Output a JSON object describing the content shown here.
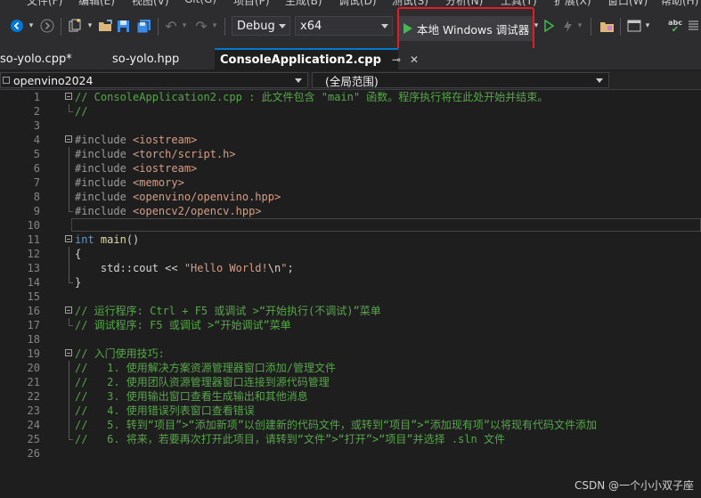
{
  "menu": {
    "items": [
      "文件(F)",
      "编辑(E)",
      "视图(V)",
      "Git(G)",
      "项目(P)",
      "生成(B)",
      "调试(D)",
      "测试(S)",
      "分析(N)",
      "工具(T)",
      "扩展(X)",
      "窗口(W)",
      "帮助(H)"
    ]
  },
  "toolbar": {
    "configuration": "Debug",
    "platform": "x64",
    "start_debug_label": "本地 Windows 调试器",
    "spell_label": "abc"
  },
  "tabs": [
    {
      "label": "so-yolo.cpp*",
      "active": false
    },
    {
      "label": "so-yolo.hpp",
      "active": false
    },
    {
      "label": "ConsoleApplication2.cpp",
      "active": true,
      "pin": "⊸",
      "close": "✕"
    }
  ],
  "navbar": {
    "project": "openvino2024",
    "scope": "(全局范围)"
  },
  "editor": {
    "current_line": 10,
    "lines": [
      {
        "n": "1",
        "fold": true,
        "guide": "",
        "segs": [
          {
            "t": "// ConsoleApplication2.cpp : 此文件包含 \"main\" 函数。程序执行将在此处开始并结束。",
            "c": "c-com"
          }
        ]
      },
      {
        "n": "2",
        "fold": false,
        "guide": "end",
        "segs": [
          {
            "t": "//",
            "c": "c-com"
          }
        ]
      },
      {
        "n": "3",
        "fold": false,
        "guide": "",
        "segs": []
      },
      {
        "n": "4",
        "fold": true,
        "guide": "",
        "segs": [
          {
            "t": "#include ",
            "c": "c-pp"
          },
          {
            "t": "<iostream>",
            "c": "c-inc"
          }
        ]
      },
      {
        "n": "5",
        "fold": false,
        "guide": "line",
        "segs": [
          {
            "t": "#include ",
            "c": "c-pp"
          },
          {
            "t": "<torch/script.h>",
            "c": "c-inc"
          }
        ]
      },
      {
        "n": "6",
        "fold": false,
        "guide": "line",
        "segs": [
          {
            "t": "#include ",
            "c": "c-pp"
          },
          {
            "t": "<iostream>",
            "c": "c-inc"
          }
        ]
      },
      {
        "n": "7",
        "fold": false,
        "guide": "line",
        "segs": [
          {
            "t": "#include ",
            "c": "c-pp"
          },
          {
            "t": "<memory>",
            "c": "c-inc"
          }
        ]
      },
      {
        "n": "8",
        "fold": false,
        "guide": "line",
        "segs": [
          {
            "t": "#include ",
            "c": "c-pp"
          },
          {
            "t": "<openvino/openvino.hpp>",
            "c": "c-inc"
          }
        ]
      },
      {
        "n": "9",
        "fold": false,
        "guide": "end",
        "segs": [
          {
            "t": "#include ",
            "c": "c-pp"
          },
          {
            "t": "<opencv2/opencv.hpp>",
            "c": "c-inc"
          }
        ]
      },
      {
        "n": "10",
        "fold": false,
        "guide": "",
        "segs": []
      },
      {
        "n": "11",
        "fold": true,
        "guide": "",
        "segs": [
          {
            "t": "int",
            "c": "c-kw"
          },
          {
            "t": " ",
            "c": "c-plain"
          },
          {
            "t": "main",
            "c": "c-fn"
          },
          {
            "t": "()",
            "c": "c-plain"
          }
        ]
      },
      {
        "n": "12",
        "fold": false,
        "guide": "line",
        "segs": [
          {
            "t": "{",
            "c": "c-plain"
          }
        ]
      },
      {
        "n": "13",
        "fold": false,
        "guide": "line",
        "segs": [
          {
            "t": "    std::cout << ",
            "c": "c-plain"
          },
          {
            "t": "\"Hello World!",
            "c": "c-str"
          },
          {
            "t": "\\n",
            "c": "c-esc"
          },
          {
            "t": "\"",
            "c": "c-str"
          },
          {
            "t": ";",
            "c": "c-plain"
          }
        ]
      },
      {
        "n": "14",
        "fold": false,
        "guide": "end",
        "segs": [
          {
            "t": "}",
            "c": "c-plain"
          }
        ]
      },
      {
        "n": "15",
        "fold": false,
        "guide": "",
        "segs": []
      },
      {
        "n": "16",
        "fold": true,
        "guide": "",
        "segs": [
          {
            "t": "// 运行程序: Ctrl + F5 或调试 >“开始执行(不调试)”菜单",
            "c": "c-com"
          }
        ]
      },
      {
        "n": "17",
        "fold": false,
        "guide": "end",
        "segs": [
          {
            "t": "// 调试程序: F5 或调试 >“开始调试”菜单",
            "c": "c-com"
          }
        ]
      },
      {
        "n": "18",
        "fold": false,
        "guide": "",
        "segs": []
      },
      {
        "n": "19",
        "fold": true,
        "guide": "",
        "segs": [
          {
            "t": "// 入门使用技巧:",
            "c": "c-com"
          }
        ]
      },
      {
        "n": "20",
        "fold": false,
        "guide": "line",
        "segs": [
          {
            "t": "//   1. 使用解决方案资源管理器窗口添加/管理文件",
            "c": "c-com"
          }
        ]
      },
      {
        "n": "21",
        "fold": false,
        "guide": "line",
        "segs": [
          {
            "t": "//   2. 使用团队资源管理器窗口连接到源代码管理",
            "c": "c-com"
          }
        ]
      },
      {
        "n": "22",
        "fold": false,
        "guide": "line",
        "segs": [
          {
            "t": "//   3. 使用输出窗口查看生成输出和其他消息",
            "c": "c-com"
          }
        ]
      },
      {
        "n": "23",
        "fold": false,
        "guide": "line",
        "segs": [
          {
            "t": "//   4. 使用错误列表窗口查看错误",
            "c": "c-com"
          }
        ]
      },
      {
        "n": "24",
        "fold": false,
        "guide": "line",
        "segs": [
          {
            "t": "//   5. 转到“项目”>“添加新项”以创建新的代码文件，或转到“项目”>“添加现有项”以将现有代码文件添加",
            "c": "c-com"
          }
        ]
      },
      {
        "n": "25",
        "fold": false,
        "guide": "end",
        "segs": [
          {
            "t": "//   6. 将来，若要再次打开此项目，请转到“文件”>“打开”>“项目”并选择 .sln 文件",
            "c": "c-com"
          }
        ]
      },
      {
        "n": "26",
        "fold": false,
        "guide": "",
        "segs": []
      }
    ]
  },
  "watermark": "CSDN @一个小小双子座"
}
